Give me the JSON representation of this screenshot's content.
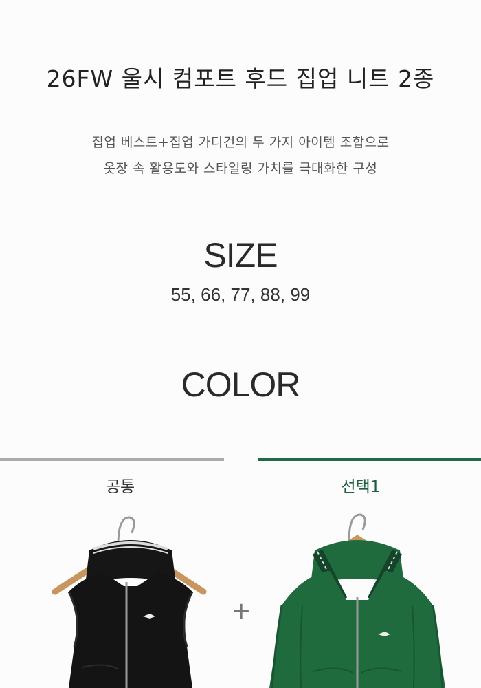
{
  "title": "26FW 울시 컴포트 후드 집업 니트 2종",
  "description": {
    "line1": "집업 베스트+집업 가디건의 두 가지 아이템 조합으로",
    "line2": "옷장 속 활용도와 스타일링 가치를 극대화한 구성"
  },
  "size": {
    "heading": "SIZE",
    "values": "55, 66, 77, 88, 99"
  },
  "color": {
    "heading": "COLOR",
    "options": [
      {
        "label": "공통",
        "garment_color": "#141414",
        "line_color": "#aaaaaa"
      },
      {
        "label": "선택1",
        "garment_color": "#1f6b3d",
        "line_color": "#1e6b4a"
      }
    ],
    "plus": "+"
  },
  "icons": {
    "left_image": "black-hooded-zip-vest-image",
    "right_image": "green-hooded-zip-cardigan-image"
  }
}
